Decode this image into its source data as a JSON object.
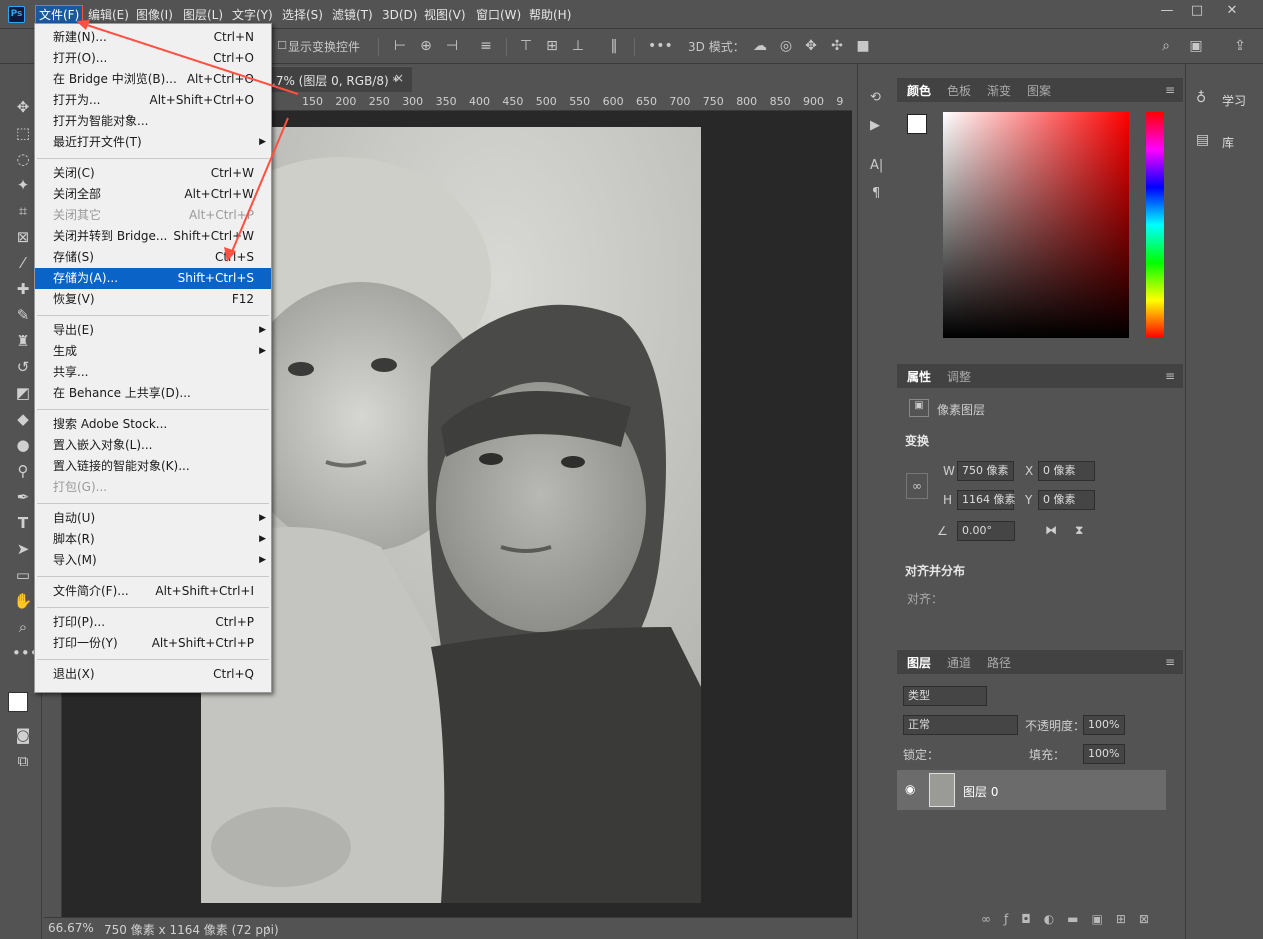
{
  "app": {
    "logo": "Ps",
    "accent": "#0a64c8"
  },
  "menubar": {
    "items": [
      "文件(F)",
      "编辑(E)",
      "图像(I)",
      "图层(L)",
      "文字(Y)",
      "选择(S)",
      "滤镜(T)",
      "3D(D)",
      "视图(V)",
      "窗口(W)",
      "帮助(H)"
    ],
    "window_controls": [
      "—",
      "□",
      "✕"
    ]
  },
  "options_bar": {
    "show_transform": "显示变换控件",
    "mode_3d": "3D 模式："
  },
  "document": {
    "tab_title": ".7% (图层 0, RGB/8) *",
    "ruler_ticks": [
      "150",
      "200",
      "250",
      "300",
      "350",
      "400",
      "450",
      "500",
      "550",
      "600",
      "650",
      "700",
      "750",
      "800",
      "850",
      "900",
      "9"
    ]
  },
  "status": {
    "zoom": "66.67%",
    "info": "750 像素 x 1164 像素 (72 ppi)"
  },
  "file_menu": {
    "groups": [
      [
        {
          "label": "新建(N)...",
          "shortcut": "Ctrl+N"
        },
        {
          "label": "打开(O)...",
          "shortcut": "Ctrl+O"
        },
        {
          "label": "在 Bridge 中浏览(B)...",
          "shortcut": "Alt+Ctrl+O"
        },
        {
          "label": "打开为...",
          "shortcut": "Alt+Shift+Ctrl+O"
        },
        {
          "label": "打开为智能对象...",
          "shortcut": ""
        },
        {
          "label": "最近打开文件(T)",
          "shortcut": "",
          "submenu": true
        }
      ],
      [
        {
          "label": "关闭(C)",
          "shortcut": "Ctrl+W"
        },
        {
          "label": "关闭全部",
          "shortcut": "Alt+Ctrl+W"
        },
        {
          "label": "关闭其它",
          "shortcut": "Alt+Ctrl+P",
          "disabled": true
        },
        {
          "label": "关闭并转到 Bridge...",
          "shortcut": "Shift+Ctrl+W"
        },
        {
          "label": "存储(S)",
          "shortcut": "Ctrl+S"
        },
        {
          "label": "存储为(A)...",
          "shortcut": "Shift+Ctrl+S",
          "selected": true
        },
        {
          "label": "恢复(V)",
          "shortcut": "F12"
        }
      ],
      [
        {
          "label": "导出(E)",
          "shortcut": "",
          "submenu": true
        },
        {
          "label": "生成",
          "shortcut": "",
          "submenu": true
        },
        {
          "label": "共享...",
          "shortcut": ""
        },
        {
          "label": "在 Behance 上共享(D)...",
          "shortcut": ""
        }
      ],
      [
        {
          "label": "搜索 Adobe Stock...",
          "shortcut": ""
        },
        {
          "label": "置入嵌入对象(L)...",
          "shortcut": ""
        },
        {
          "label": "置入链接的智能对象(K)...",
          "shortcut": ""
        },
        {
          "label": "打包(G)...",
          "shortcut": "",
          "disabled": true
        }
      ],
      [
        {
          "label": "自动(U)",
          "shortcut": "",
          "submenu": true
        },
        {
          "label": "脚本(R)",
          "shortcut": "",
          "submenu": true
        },
        {
          "label": "导入(M)",
          "shortcut": "",
          "submenu": true
        }
      ],
      [
        {
          "label": "文件简介(F)...",
          "shortcut": "Alt+Shift+Ctrl+I"
        }
      ],
      [
        {
          "label": "打印(P)...",
          "shortcut": "Ctrl+P"
        },
        {
          "label": "打印一份(Y)",
          "shortcut": "Alt+Shift+Ctrl+P"
        }
      ],
      [
        {
          "label": "退出(X)",
          "shortcut": "Ctrl+Q"
        }
      ]
    ]
  },
  "color_panel": {
    "tabs": [
      "颜色",
      "色板",
      "渐变",
      "图案"
    ]
  },
  "properties_panel": {
    "tabs": [
      "属性",
      "调整"
    ],
    "layer_type": "像素图层",
    "transform_title": "变换",
    "w_label": "W",
    "w_value": "750 像素",
    "x_label": "X",
    "x_value": "0 像素",
    "h_label": "H",
    "h_value": "1164 像素",
    "y_label": "Y",
    "y_value": "0 像素",
    "angle_value": "0.00°",
    "align_title": "对齐并分布",
    "align_label": "对齐："
  },
  "layers_panel": {
    "tabs": [
      "图层",
      "通道",
      "路径"
    ],
    "filter_kind": "类型",
    "blend_mode": "正常",
    "opacity_label": "不透明度：",
    "opacity_value": "100%",
    "lock_label": "锁定：",
    "fill_label": "填充：",
    "fill_value": "100%",
    "layers": [
      {
        "name": "图层 0",
        "visible": true
      }
    ]
  },
  "learn_panel": {
    "learn": "学习",
    "library": "库"
  }
}
